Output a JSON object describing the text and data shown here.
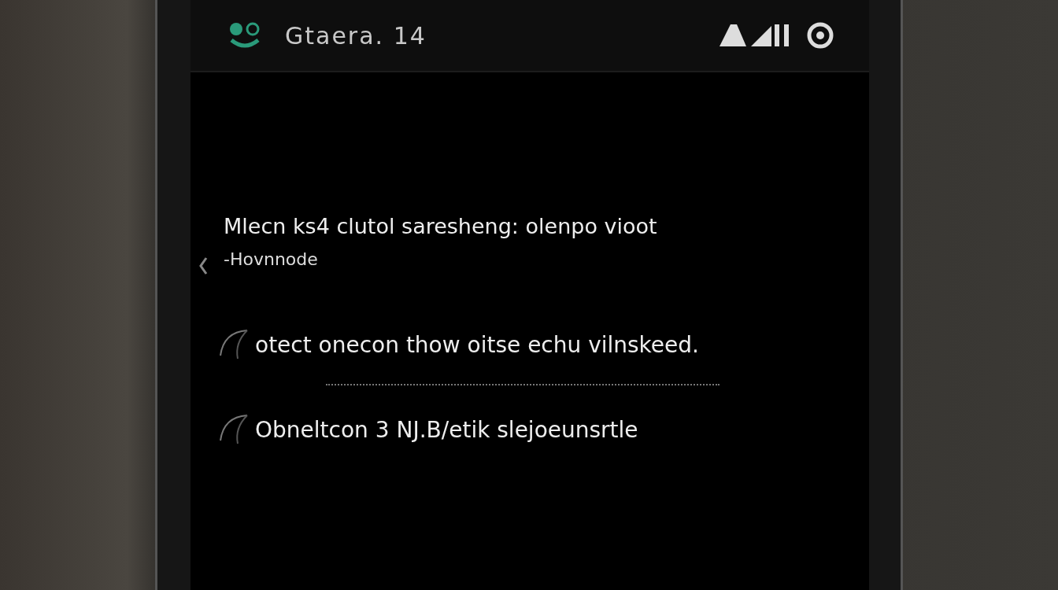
{
  "header": {
    "title": "Gtaera. 14"
  },
  "intro": {
    "text": "Mlecn ks4  clutol saresheng: olenpo vioot",
    "subtext": "-Hovnnode"
  },
  "items": [
    {
      "text": "otect onecon thow oitse echu vilnskeed."
    },
    {
      "text": "Obneltcon 3 NJ.B/etik slejoeunsrtle"
    }
  ]
}
